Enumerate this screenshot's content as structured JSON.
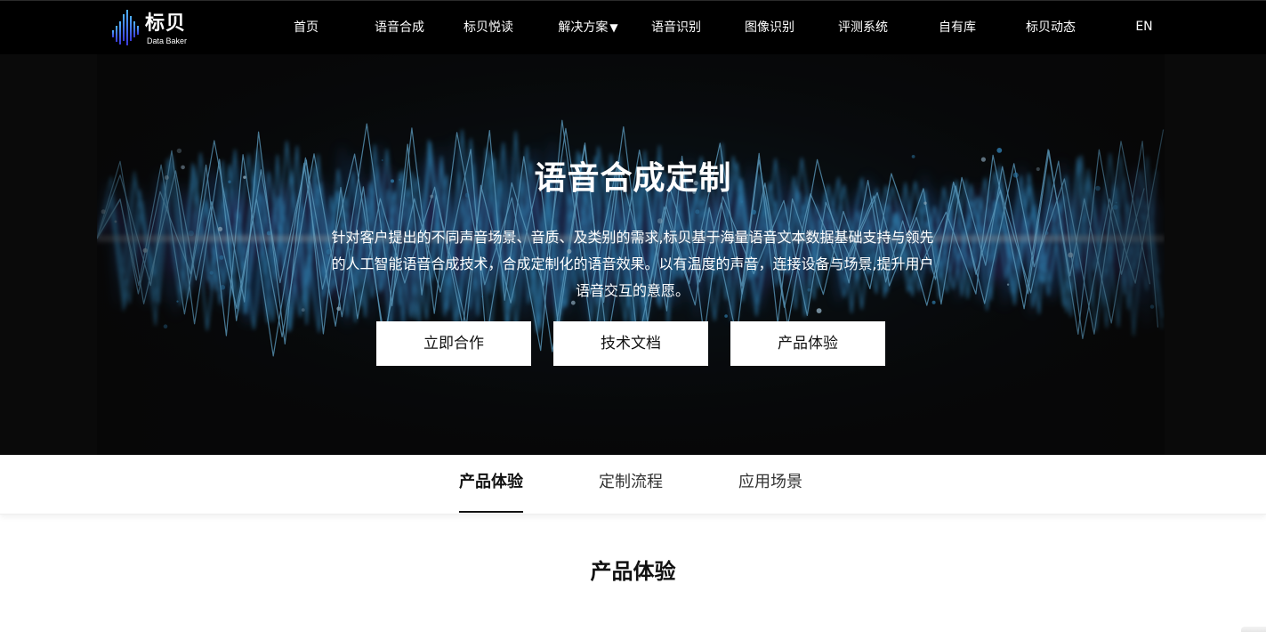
{
  "header": {
    "logo": {
      "cn": "标贝",
      "en": "Data Baker"
    },
    "nav": [
      {
        "label": "首页"
      },
      {
        "label": "语音合成"
      },
      {
        "label": "标贝悦读"
      },
      {
        "label": "解决方案",
        "caret": "▼"
      },
      {
        "label": "语音识别"
      },
      {
        "label": "图像识别"
      },
      {
        "label": "评测系统"
      },
      {
        "label": "自有库"
      },
      {
        "label": "标贝动态"
      },
      {
        "label": "EN"
      }
    ]
  },
  "hero": {
    "title": "语音合成定制",
    "description_lines": [
      "针对客户提出的不同声音场景、音质、及类别的需求,标贝基于海量语音文本数据基础支持与领先",
      "的人工智能语音合成技术，合成定制化的语音效果。以有温度的声音，连接设备与场景,提升用户",
      "语音交互的意愿。"
    ],
    "buttons": [
      {
        "label": "立即合作"
      },
      {
        "label": "技术文档"
      },
      {
        "label": "产品体验"
      }
    ]
  },
  "tabs": [
    {
      "label": "产品体验",
      "active": true
    },
    {
      "label": "定制流程",
      "active": false
    },
    {
      "label": "应用场景",
      "active": false
    }
  ],
  "section": {
    "title": "产品体验"
  },
  "colors": {
    "nav_bg": "#000000",
    "hero_bg": "#0a0a0a",
    "wave": "#3fa6e6",
    "wave_glow": "#7ad0ff"
  }
}
